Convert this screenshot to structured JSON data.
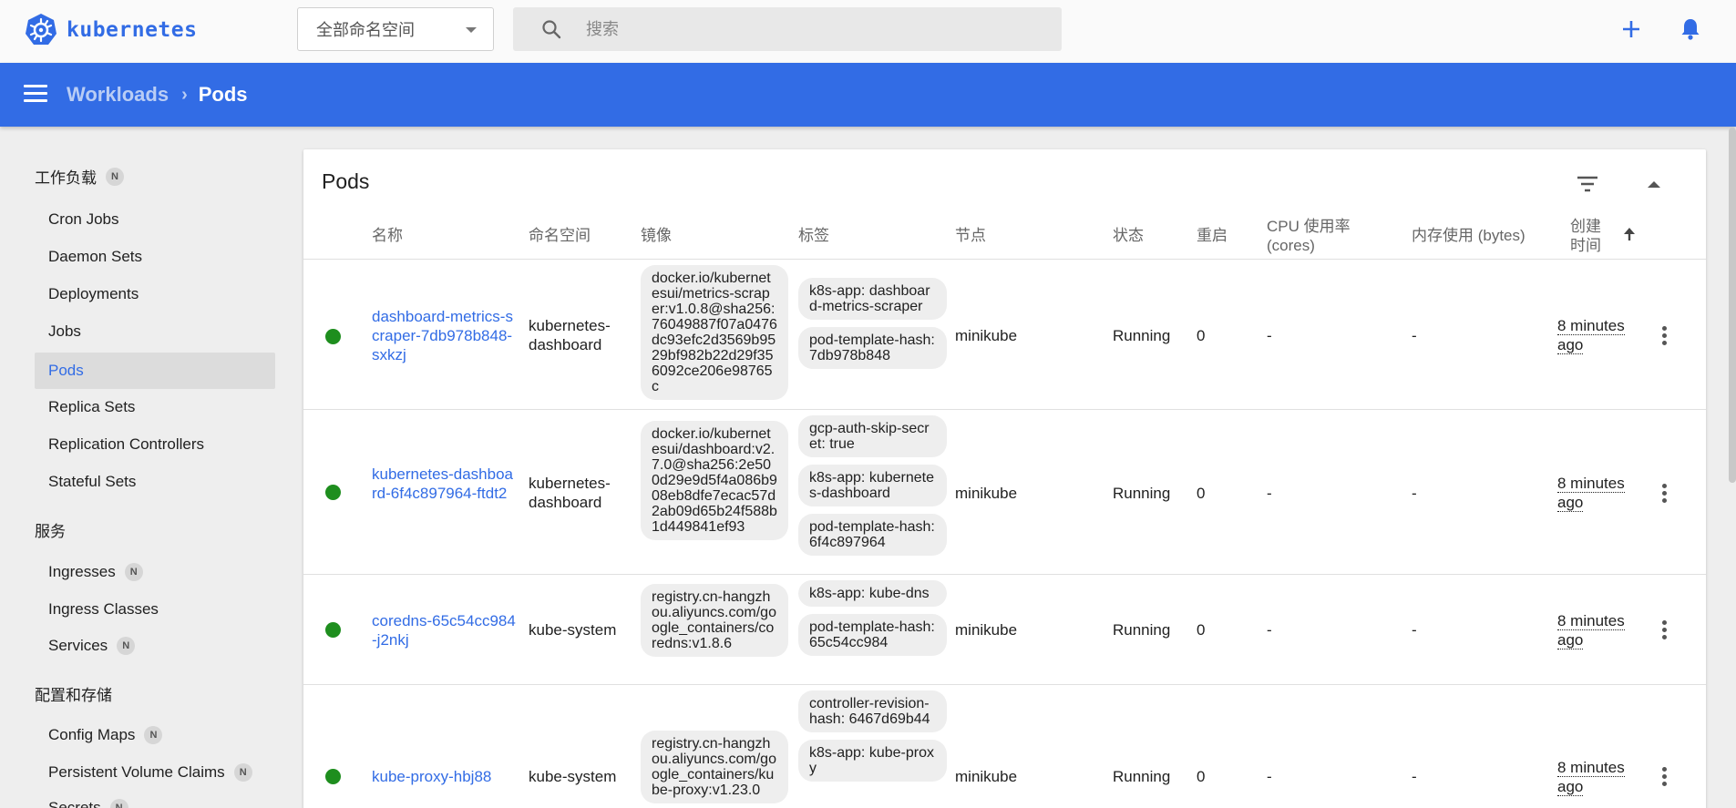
{
  "app": {
    "name": "kubernetes",
    "brand_color": "#326ce5"
  },
  "topbar": {
    "namespace_select": "全部命名空间",
    "search_placeholder": "搜索"
  },
  "breadcrumb": {
    "parent": "Workloads",
    "current": "Pods"
  },
  "sidebar": {
    "sections": [
      {
        "title": "工作负载",
        "badge": "N"
      },
      {
        "title": "服务"
      },
      {
        "title": "配置和存储"
      }
    ],
    "workloads": [
      "Cron Jobs",
      "Daemon Sets",
      "Deployments",
      "Jobs",
      "Pods",
      "Replica Sets",
      "Replication Controllers",
      "Stateful Sets"
    ],
    "services": [
      {
        "label": "Ingresses",
        "badge": "N"
      },
      {
        "label": "Ingress Classes"
      },
      {
        "label": "Services",
        "badge": "N"
      }
    ],
    "config": [
      {
        "label": "Config Maps",
        "badge": "N"
      },
      {
        "label": "Persistent Volume Claims",
        "badge": "N"
      },
      {
        "label": "Secrets",
        "badge": "N"
      }
    ],
    "active_item": "Pods"
  },
  "card": {
    "title": "Pods",
    "columns": {
      "name": "名称",
      "namespace": "命名空间",
      "images": "镜像",
      "labels": "标签",
      "node": "节点",
      "status": "状态",
      "restarts": "重启",
      "cpu": "CPU 使用率 (cores)",
      "memory": "内存使用 (bytes)",
      "created": "创建时间"
    },
    "rows": [
      {
        "name": "dashboard-metrics-scraper-7db978b848-sxkzj",
        "namespace": "kubernetes-dashboard",
        "image": "docker.io/kubernetesui/metrics-scraper:v1.0.8@sha256:76049887f07a0476dc93efc2d3569b9529bf982b22d29f356092ce206e98765c",
        "labels": [
          "k8s-app: dashboard-metrics-scraper",
          "pod-template-hash: 7db978b848"
        ],
        "node": "minikube",
        "status": "Running",
        "restarts": "0",
        "cpu": "-",
        "memory": "-",
        "created": "8 minutes ago"
      },
      {
        "name": "kubernetes-dashboard-6f4c897964-ftdt2",
        "namespace": "kubernetes-dashboard",
        "image": "docker.io/kubernetesui/dashboard:v2.7.0@sha256:2e500d29e9d5f4a086b908eb8dfe7ecac57d2ab09d65b24f588b1d449841ef93",
        "labels": [
          "gcp-auth-skip-secret: true",
          "k8s-app: kubernetes-dashboard",
          "pod-template-hash: 6f4c897964"
        ],
        "node": "minikube",
        "status": "Running",
        "restarts": "0",
        "cpu": "-",
        "memory": "-",
        "created": "8 minutes ago"
      },
      {
        "name": "coredns-65c54cc984-j2nkj",
        "namespace": "kube-system",
        "image": "registry.cn-hangzhou.aliyuncs.com/google_containers/coredns:v1.8.6",
        "labels": [
          "k8s-app: kube-dns",
          "pod-template-hash: 65c54cc984"
        ],
        "node": "minikube",
        "status": "Running",
        "restarts": "0",
        "cpu": "-",
        "memory": "-",
        "created": "8 minutes ago"
      },
      {
        "name": "kube-proxy-hbj88",
        "namespace": "kube-system",
        "image": "registry.cn-hangzhou.aliyuncs.com/google_containers/kube-proxy:v1.23.0",
        "labels": [
          "controller-revision-hash: 6467d69b44",
          "k8s-app: kube-proxy"
        ],
        "node": "minikube",
        "status": "Running",
        "restarts": "0",
        "cpu": "-",
        "memory": "-",
        "created": "8 minutes ago"
      }
    ],
    "status_color": "#1e8e1e"
  },
  "icons": {
    "logo": "kubernetes-wheel-icon",
    "search": "search-icon",
    "add": "plus-icon",
    "notifications": "bell-icon",
    "menu": "menu-icon",
    "breadcrumb_sep": "chevron-right-icon",
    "filter": "filter-icon",
    "collapse": "caret-up-icon",
    "sort": "arrow-up-icon",
    "row_menu": "more-vert-icon"
  }
}
